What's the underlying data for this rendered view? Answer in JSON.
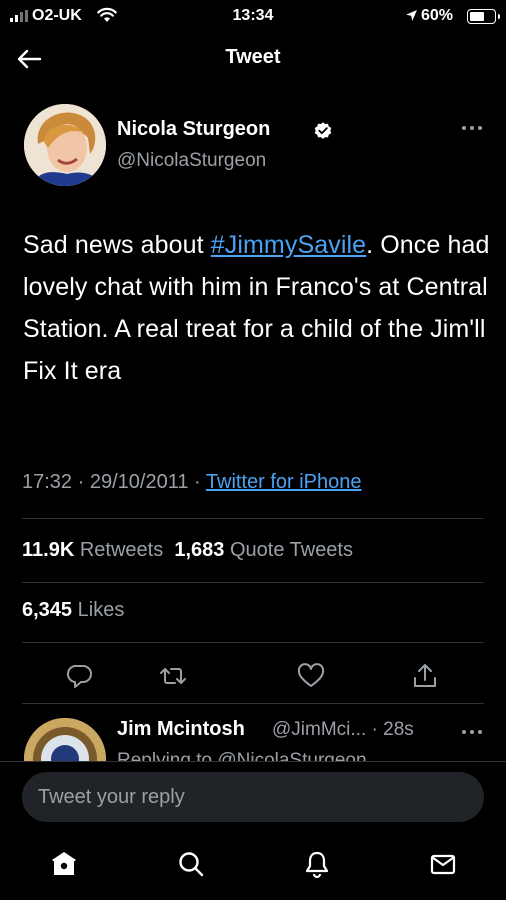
{
  "status_bar": {
    "carrier": "O2-UK",
    "time": "13:34",
    "battery_pct": "60%",
    "battery_level": 0.6
  },
  "header": {
    "title": "Tweet"
  },
  "tweet": {
    "author_name": "Nicola Sturgeon",
    "author_handle": "@NicolaSturgeon",
    "text_before": "Sad news about ",
    "hashtag": "#JimmySavile",
    "text_after": ". Once had lovely chat with him in Franco's at Central Station. A real treat for a child of the Jim'll Fix It era",
    "time": "17:32",
    "date": "29/10/2011",
    "source": "Twitter for iPhone",
    "retweets_count": "11.9K",
    "retweets_label": "Retweets",
    "quotes_count": "1,683",
    "quotes_label": "Quote Tweets",
    "likes_count": "6,345",
    "likes_label": "Likes"
  },
  "reply_preview": {
    "name": "Jim Mcintosh",
    "handle": "@JimMci...",
    "time": "28s",
    "subtext": "Replying to @NicolaSturgeon"
  },
  "compose": {
    "placeholder": "Tweet your reply"
  },
  "icons": {
    "back": "back-arrow-icon",
    "verified": "verified-badge-icon",
    "more": "more-icon",
    "reply": "reply-icon",
    "retweet": "retweet-icon",
    "like": "heart-icon",
    "share": "share-icon",
    "home": "home-icon",
    "search": "search-icon",
    "notifications": "bell-icon",
    "messages": "mail-icon"
  },
  "colors": {
    "link": "#4aa3f2",
    "verified": "#ffffff",
    "background": "#000000"
  }
}
